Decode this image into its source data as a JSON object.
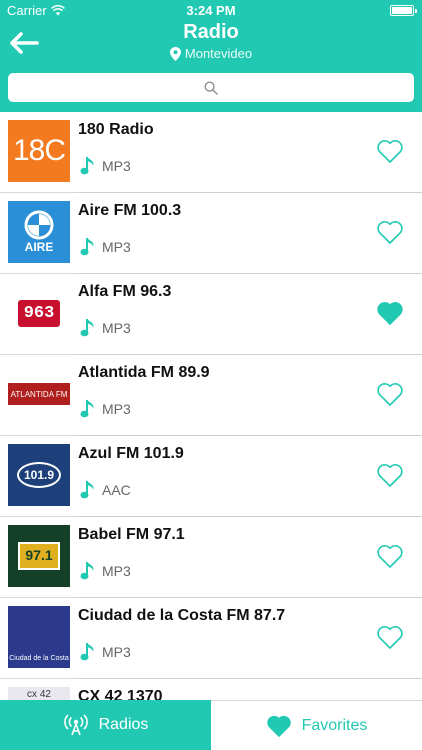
{
  "status_bar": {
    "carrier": "Carrier",
    "time": "3:24 PM"
  },
  "header": {
    "title": "Radio",
    "location": "Montevideo"
  },
  "search": {
    "placeholder": ""
  },
  "colors": {
    "accent": "#22c9b2"
  },
  "stations": [
    {
      "name": "180 Radio",
      "format": "MP3",
      "favorite": false,
      "logo_text": "18C"
    },
    {
      "name": "Aire FM 100.3",
      "format": "MP3",
      "favorite": false,
      "logo_text": "AIRE"
    },
    {
      "name": "Alfa FM 96.3",
      "format": "MP3",
      "favorite": true,
      "logo_text": "963"
    },
    {
      "name": "Atlantida FM 89.9",
      "format": "MP3",
      "favorite": false,
      "logo_text": "ATLANTIDA FM"
    },
    {
      "name": "Azul FM 101.9",
      "format": "AAC",
      "favorite": false,
      "logo_text": "101.9"
    },
    {
      "name": "Babel FM 97.1",
      "format": "MP3",
      "favorite": false,
      "logo_text": "97.1"
    },
    {
      "name": "Ciudad de la Costa FM 87.7",
      "format": "MP3",
      "favorite": false,
      "logo_text": "Ciudad de la Costa"
    },
    {
      "name": "CX 42 1370",
      "format": "",
      "favorite": false,
      "logo_text": "cx 42"
    }
  ],
  "tabs": {
    "radios": "Radios",
    "favorites": "Favorites"
  },
  "icons": {
    "back": "arrow-left-icon",
    "location": "location-pin-icon",
    "search": "search-icon",
    "format": "music-note-icon",
    "favorite": "heart-icon",
    "radios_tab": "radio-tower-icon",
    "favorites_tab": "heart-icon"
  }
}
